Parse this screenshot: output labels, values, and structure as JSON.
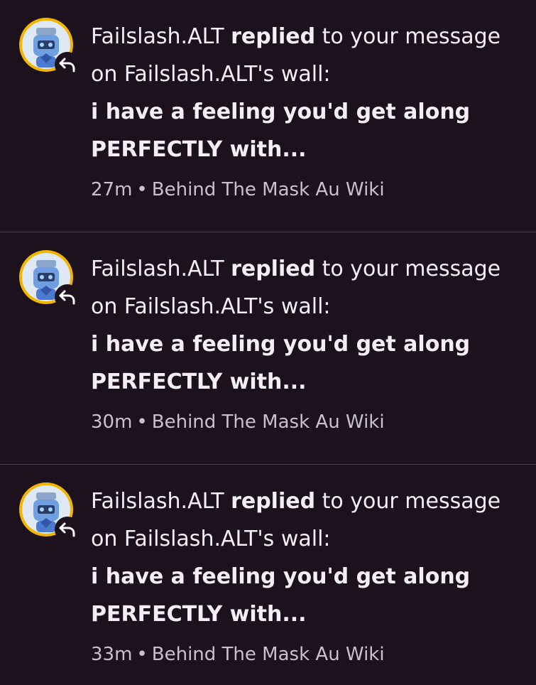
{
  "notifications": [
    {
      "actor": "Failslash.ALT",
      "action": "replied",
      "text_after_action": "to your message on Failslash.ALT's wall:",
      "snippet": "i have a feeling you'd get along PERFECTLY with...",
      "time": "27m",
      "separator": "•",
      "wiki": "Behind The Mask Au Wiki"
    },
    {
      "actor": "Failslash.ALT",
      "action": "replied",
      "text_after_action": "to your message on Failslash.ALT's wall:",
      "snippet": "i have a feeling you'd get along PERFECTLY with...",
      "time": "30m",
      "separator": "•",
      "wiki": "Behind The Mask Au Wiki"
    },
    {
      "actor": "Failslash.ALT",
      "action": "replied",
      "text_after_action": "to your message on Failslash.ALT's wall:",
      "snippet": "i have a feeling you'd get along PERFECTLY with...",
      "time": "33m",
      "separator": "•",
      "wiki": "Behind The Mask Au Wiki"
    }
  ],
  "icons": {
    "avatar": "avatar",
    "badge": "reply-arrow-icon"
  },
  "colors": {
    "background": "#1c111d",
    "divider": "#4a3f4c",
    "avatar_ring": "#f2b500",
    "text": "#f4eff5",
    "meta_text": "#c9c1cb"
  }
}
